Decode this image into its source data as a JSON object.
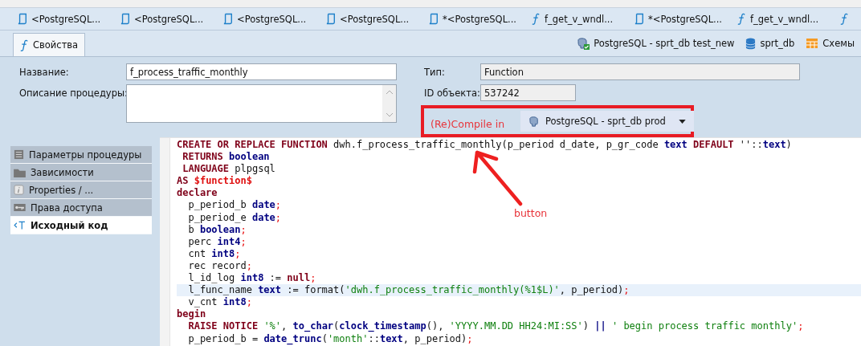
{
  "editor_tabs": [
    {
      "label": "<PostgreSQL...",
      "kind": "procedure"
    },
    {
      "label": "<PostgreSQL...",
      "kind": "procedure"
    },
    {
      "label": "<PostgreSQL...",
      "kind": "procedure"
    },
    {
      "label": "<PostgreSQL...",
      "kind": "procedure"
    },
    {
      "label": "*<PostgreSQL...",
      "kind": "procedure"
    },
    {
      "label": "f_get_v_wndl...",
      "kind": "function"
    },
    {
      "label": "*<PostgreSQL...",
      "kind": "procedure"
    },
    {
      "label": "f_get_v_wndl...",
      "kind": "function"
    },
    {
      "kind": "function"
    }
  ],
  "header": {
    "tab": {
      "label": "Свойства",
      "selected": true
    },
    "connections": [
      {
        "label": "PostgreSQL - sprt_db test_new",
        "kind": "connection"
      },
      {
        "label": "sprt_db",
        "kind": "database"
      },
      {
        "label": "Схемы",
        "kind": "schemas"
      }
    ]
  },
  "form": {
    "name_label": "Название:",
    "name_value": "f_process_traffic_monthly",
    "description_label": "Описание процедуры:",
    "type_label": "Тип:",
    "type_value": "Function",
    "id_label": "ID объекта:",
    "id_value": "537242"
  },
  "compile": {
    "label": "(Re)Compile in",
    "target": "PostgreSQL - sprt_db prod"
  },
  "annotation": {
    "label": "button"
  },
  "nav": [
    {
      "label": "Параметры процедуры",
      "kind": "list",
      "selected": false
    },
    {
      "label": "Зависимости",
      "kind": "folder",
      "selected": false
    },
    {
      "label": "Properties / ...",
      "kind": "info",
      "selected": false
    },
    {
      "label": "Права доступа",
      "kind": "key",
      "selected": false
    },
    {
      "label": "Исходный код",
      "kind": "source",
      "selected": true
    }
  ],
  "code": [
    {
      "highlighted": false,
      "tokens": [
        {
          "text": "CREATE OR REPLACE FUNCTION",
          "kind": "keyword"
        },
        {
          "text": " dwh.f_process_traffic_monthly(p_period d_date, p_gr_code",
          "kind": "plain"
        },
        {
          "text": " text",
          "kind": "type"
        },
        {
          "text": " DEFAULT",
          "kind": "keyword"
        },
        {
          "text": " ''::",
          "kind": "plain"
        },
        {
          "text": "text",
          "kind": "type"
        },
        {
          "text": ")",
          "kind": "plain"
        }
      ]
    },
    {
      "highlighted": false,
      "tokens": [
        {
          "text": " RETURNS",
          "kind": "keyword"
        },
        {
          "text": " boolean",
          "kind": "type"
        }
      ]
    },
    {
      "highlighted": false,
      "tokens": [
        {
          "text": " LANGUAGE",
          "kind": "keyword"
        },
        {
          "text": " plpgsql",
          "kind": "plain"
        }
      ]
    },
    {
      "highlighted": false,
      "tokens": [
        {
          "text": "AS",
          "kind": "keyword"
        },
        {
          "text": " $function$",
          "kind": "dollar"
        }
      ]
    },
    {
      "highlighted": false,
      "tokens": [
        {
          "text": "declare",
          "kind": "keyword"
        }
      ]
    },
    {
      "highlighted": false,
      "tokens": [
        {
          "text": "  p_period_b",
          "kind": "plain"
        },
        {
          "text": " date",
          "kind": "type"
        },
        {
          "text": ";",
          "kind": "punct"
        }
      ]
    },
    {
      "highlighted": false,
      "tokens": [
        {
          "text": "  p_period_e",
          "kind": "plain"
        },
        {
          "text": " date",
          "kind": "type"
        },
        {
          "text": ";",
          "kind": "punct"
        }
      ]
    },
    {
      "highlighted": false,
      "tokens": [
        {
          "text": "  b",
          "kind": "plain"
        },
        {
          "text": " boolean",
          "kind": "type"
        },
        {
          "text": ";",
          "kind": "punct"
        }
      ]
    },
    {
      "highlighted": false,
      "tokens": [
        {
          "text": "  perc",
          "kind": "plain"
        },
        {
          "text": " int4",
          "kind": "type"
        },
        {
          "text": ";",
          "kind": "punct"
        }
      ]
    },
    {
      "highlighted": false,
      "tokens": [
        {
          "text": "  cnt",
          "kind": "plain"
        },
        {
          "text": " int8",
          "kind": "type"
        },
        {
          "text": ";",
          "kind": "punct"
        }
      ]
    },
    {
      "highlighted": false,
      "tokens": [
        {
          "text": "  rec record",
          "kind": "plain"
        },
        {
          "text": ";",
          "kind": "punct"
        }
      ]
    },
    {
      "highlighted": false,
      "tokens": [
        {
          "text": "  l_id_log",
          "kind": "plain"
        },
        {
          "text": " int8",
          "kind": "type"
        },
        {
          "text": " :=",
          "kind": "plain"
        },
        {
          "text": " null",
          "kind": "keyword"
        },
        {
          "text": ";",
          "kind": "punct"
        }
      ]
    },
    {
      "highlighted": true,
      "tokens": [
        {
          "text": "  l_func_name",
          "kind": "plain"
        },
        {
          "text": " text",
          "kind": "type"
        },
        {
          "text": " := format(",
          "kind": "plain"
        },
        {
          "text": "'dwh.f_process_traffic_monthly(%1$L)'",
          "kind": "string"
        },
        {
          "text": ", p_period)",
          "kind": "plain"
        },
        {
          "text": ";",
          "kind": "punct"
        }
      ]
    },
    {
      "highlighted": false,
      "tokens": [
        {
          "text": "  v_cnt",
          "kind": "plain"
        },
        {
          "text": " int8",
          "kind": "type"
        },
        {
          "text": ";",
          "kind": "punct"
        }
      ]
    },
    {
      "highlighted": false,
      "tokens": [
        {
          "text": "begin",
          "kind": "keyword"
        }
      ]
    },
    {
      "highlighted": false,
      "tokens": [
        {
          "text": "  RAISE NOTICE",
          "kind": "keyword"
        },
        {
          "text": " '%'",
          "kind": "string"
        },
        {
          "text": ",",
          "kind": "plain"
        },
        {
          "text": " to_char",
          "kind": "type"
        },
        {
          "text": "(",
          "kind": "plain"
        },
        {
          "text": "clock_timestamp",
          "kind": "type"
        },
        {
          "text": "(),",
          "kind": "plain"
        },
        {
          "text": " 'YYYY.MM.DD HH24:MI:SS'",
          "kind": "string"
        },
        {
          "text": ")",
          "kind": "plain"
        },
        {
          "text": " ||",
          "kind": "type"
        },
        {
          "text": " ' begin process traffic monthly'",
          "kind": "string"
        },
        {
          "text": ";",
          "kind": "punct"
        }
      ]
    },
    {
      "highlighted": false,
      "tokens": [
        {
          "text": "  p_period_b =",
          "kind": "plain"
        },
        {
          "text": " date_trunc",
          "kind": "type"
        },
        {
          "text": "(",
          "kind": "plain"
        },
        {
          "text": "'month'",
          "kind": "string"
        },
        {
          "text": "::",
          "kind": "plain"
        },
        {
          "text": "text",
          "kind": "type"
        },
        {
          "text": ", p_period)",
          "kind": "plain"
        },
        {
          "text": ";",
          "kind": "punct"
        }
      ]
    }
  ]
}
